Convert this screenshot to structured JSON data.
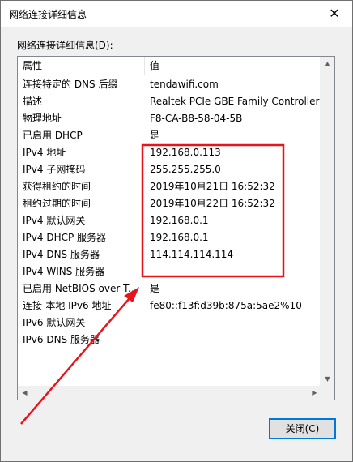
{
  "window": {
    "title": "网络连接详细信息",
    "close_icon": "✕"
  },
  "group_label": "网络连接详细信息(D):",
  "columns": {
    "property": "属性",
    "value": "值"
  },
  "rows": [
    {
      "property": "连接特定的 DNS 后缀",
      "value": "tendawifi.com"
    },
    {
      "property": "描述",
      "value": "Realtek PCIe GBE Family Controller"
    },
    {
      "property": "物理地址",
      "value": "F8-CA-B8-58-04-5B"
    },
    {
      "property": "已启用 DHCP",
      "value": "是"
    },
    {
      "property": "IPv4 地址",
      "value": "192.168.0.113"
    },
    {
      "property": "IPv4 子网掩码",
      "value": "255.255.255.0"
    },
    {
      "property": "获得租约的时间",
      "value": "2019年10月21日 16:52:32"
    },
    {
      "property": "租约过期的时间",
      "value": "2019年10月22日 16:52:32"
    },
    {
      "property": "IPv4 默认网关",
      "value": "192.168.0.1"
    },
    {
      "property": "IPv4 DHCP 服务器",
      "value": "192.168.0.1"
    },
    {
      "property": "IPv4 DNS 服务器",
      "value": "114.114.114.114"
    },
    {
      "property": "IPv4 WINS 服务器",
      "value": ""
    },
    {
      "property": "已启用 NetBIOS over T...",
      "value": "是"
    },
    {
      "property": "连接-本地 IPv6 地址",
      "value": "fe80::f13f:d39b:875a:5ae2%10"
    },
    {
      "property": "IPv6 默认网关",
      "value": ""
    },
    {
      "property": "IPv6 DNS 服务器",
      "value": ""
    }
  ],
  "buttons": {
    "close_label": "关闭(C)"
  },
  "colors": {
    "annotation": "#e8141c",
    "focus": "#0078d7"
  }
}
